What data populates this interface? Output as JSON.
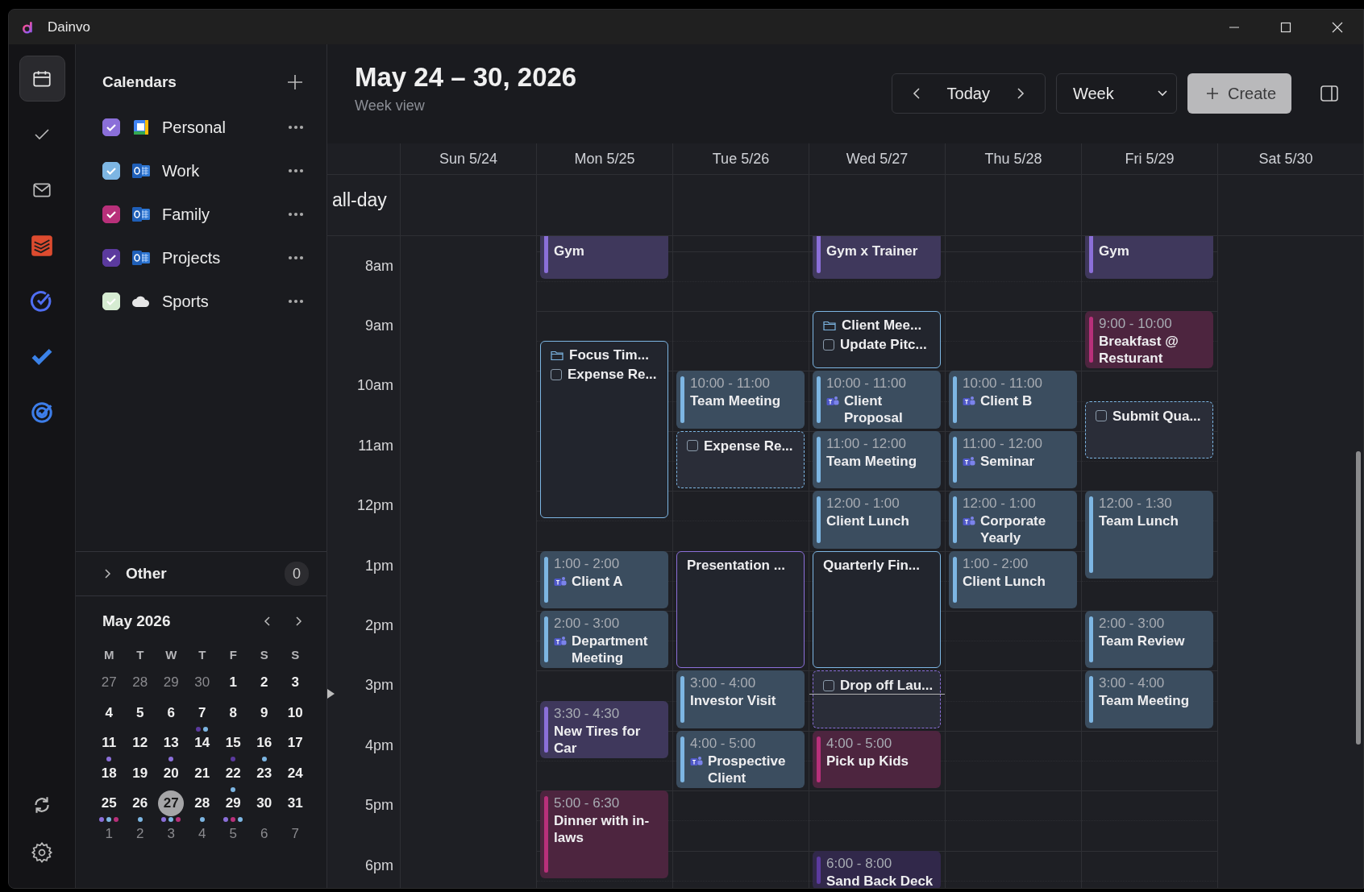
{
  "window": {
    "title": "Dainvo"
  },
  "rail": [
    {
      "kind": "calendar",
      "selected": true
    },
    {
      "kind": "check",
      "selected": false
    },
    {
      "kind": "mail",
      "selected": false
    },
    {
      "kind": "stack",
      "selected": false
    },
    {
      "kind": "ring-check",
      "selected": false
    },
    {
      "kind": "blue-check",
      "selected": false
    },
    {
      "kind": "target-check",
      "selected": false
    }
  ],
  "rail_bottom": [
    {
      "kind": "sync"
    },
    {
      "kind": "settings"
    }
  ],
  "calendars": {
    "title": "Calendars",
    "items": [
      {
        "label": "Personal",
        "checked": true,
        "color": "#8b6fd9",
        "kind": "google"
      },
      {
        "label": "Work",
        "checked": true,
        "color": "#7db6e3",
        "kind": "outlook"
      },
      {
        "label": "Family",
        "checked": true,
        "color": "#b8307a",
        "kind": "outlook"
      },
      {
        "label": "Projects",
        "checked": true,
        "color": "#5b3a9e",
        "kind": "outlook"
      },
      {
        "label": "Sports",
        "checked": true,
        "color": "#d6ecd2",
        "kind": "cloud"
      }
    ]
  },
  "other": {
    "label": "Other",
    "count": "0",
    "expanded": false
  },
  "mini_calendar": {
    "title": "May 2026",
    "weekdays": [
      "M",
      "T",
      "W",
      "T",
      "F",
      "S",
      "S"
    ],
    "days": [
      {
        "label": "27",
        "muted": true,
        "selected": false
      },
      {
        "label": "28",
        "muted": true,
        "selected": false
      },
      {
        "label": "29",
        "muted": true,
        "selected": false
      },
      {
        "label": "30",
        "muted": true,
        "selected": false
      },
      {
        "label": "1",
        "muted": false,
        "selected": false
      },
      {
        "label": "2",
        "muted": false,
        "selected": false
      },
      {
        "label": "3",
        "muted": false,
        "selected": false
      },
      {
        "label": "4",
        "muted": false,
        "selected": false
      },
      {
        "label": "5",
        "muted": false,
        "selected": false
      },
      {
        "label": "6",
        "muted": false,
        "selected": false
      },
      {
        "label": "7",
        "muted": false,
        "selected": false,
        "dots": [
          {
            "color": "#5b3a9e"
          },
          {
            "color": "#7db6e3"
          }
        ]
      },
      {
        "label": "8",
        "muted": false,
        "selected": false
      },
      {
        "label": "9",
        "muted": false,
        "selected": false
      },
      {
        "label": "10",
        "muted": false,
        "selected": false
      },
      {
        "label": "11",
        "muted": false,
        "selected": false,
        "dots": [
          {
            "color": "#8b6fd9"
          }
        ]
      },
      {
        "label": "12",
        "muted": false,
        "selected": false
      },
      {
        "label": "13",
        "muted": false,
        "selected": false,
        "dots": [
          {
            "color": "#8b6fd9"
          }
        ]
      },
      {
        "label": "14",
        "muted": false,
        "selected": false
      },
      {
        "label": "15",
        "muted": false,
        "selected": false,
        "dots": [
          {
            "color": "#5b3a9e"
          }
        ]
      },
      {
        "label": "16",
        "muted": false,
        "selected": false,
        "dots": [
          {
            "color": "#7db6e3"
          }
        ]
      },
      {
        "label": "17",
        "muted": false,
        "selected": false
      },
      {
        "label": "18",
        "muted": false,
        "selected": false
      },
      {
        "label": "19",
        "muted": false,
        "selected": false
      },
      {
        "label": "20",
        "muted": false,
        "selected": false
      },
      {
        "label": "21",
        "muted": false,
        "selected": false
      },
      {
        "label": "22",
        "muted": false,
        "selected": false,
        "dots": [
          {
            "color": "#7db6e3"
          }
        ]
      },
      {
        "label": "23",
        "muted": false,
        "selected": false
      },
      {
        "label": "24",
        "muted": false,
        "selected": false
      },
      {
        "label": "25",
        "muted": false,
        "selected": false,
        "dots": [
          {
            "color": "#8b6fd9"
          },
          {
            "color": "#7db6e3"
          },
          {
            "color": "#b8307a"
          }
        ]
      },
      {
        "label": "26",
        "muted": false,
        "selected": false,
        "dots": [
          {
            "color": "#7db6e3"
          }
        ]
      },
      {
        "label": "27",
        "muted": false,
        "selected": true,
        "dots": [
          {
            "color": "#8b6fd9"
          },
          {
            "color": "#7db6e3"
          },
          {
            "color": "#b8307a"
          }
        ]
      },
      {
        "label": "28",
        "muted": false,
        "selected": false,
        "dots": [
          {
            "color": "#7db6e3"
          }
        ]
      },
      {
        "label": "29",
        "muted": false,
        "selected": false,
        "dots": [
          {
            "color": "#8b6fd9"
          },
          {
            "color": "#b8307a"
          },
          {
            "color": "#7db6e3"
          }
        ]
      },
      {
        "label": "30",
        "muted": false,
        "selected": false
      },
      {
        "label": "31",
        "muted": false,
        "selected": false
      },
      {
        "label": "1",
        "muted": true,
        "selected": false
      },
      {
        "label": "2",
        "muted": true,
        "selected": false
      },
      {
        "label": "3",
        "muted": true,
        "selected": false
      },
      {
        "label": "4",
        "muted": true,
        "selected": false
      },
      {
        "label": "5",
        "muted": true,
        "selected": false
      },
      {
        "label": "6",
        "muted": true,
        "selected": false
      },
      {
        "label": "7",
        "muted": true,
        "selected": false
      }
    ]
  },
  "header": {
    "title": "May 24 – 30, 2026",
    "subtitle": "Week view",
    "today": "Today",
    "view": "Week",
    "create": "Create"
  },
  "allday_label": "all-day",
  "hours": [
    "8am",
    "9am",
    "10am",
    "11am",
    "12pm",
    "1pm",
    "2pm",
    "3pm",
    "4pm",
    "5pm",
    "6pm"
  ],
  "days": [
    {
      "label": "Sun 5/24"
    },
    {
      "label": "Mon 5/25",
      "events": [
        {
          "kind": "event",
          "color": "#8b6fd9",
          "title": "Gym"
        },
        {
          "kind": "group",
          "color": "#7db6e3",
          "items": [
            {
              "kind": "folder",
              "text": "Focus Tim..."
            },
            {
              "kind": "task",
              "text": "Expense Re...",
              "checked": false
            }
          ]
        },
        {
          "kind": "event",
          "color": "#7db6e3",
          "time": "1:00 - 2:00",
          "title": "Client A",
          "teams": true
        },
        {
          "kind": "event",
          "color": "#7db6e3",
          "time": "2:00 - 3:00",
          "title": "Department Meeting",
          "teams": true
        },
        {
          "kind": "event",
          "color": "#8b6fd9",
          "time": "3:30 - 4:30",
          "title": "New Tires for Car"
        },
        {
          "kind": "event",
          "color": "#b8307a",
          "time": "5:00 - 6:30",
          "title": "Dinner with in-laws"
        }
      ]
    },
    {
      "label": "Tue 5/26",
      "events": [
        {
          "kind": "event",
          "color": "#7db6e3",
          "time": "10:00 - 11:00",
          "title": "Team Meeting"
        },
        {
          "kind": "task",
          "color": "#7db6e3",
          "title": "Expense Re...",
          "checked": false
        },
        {
          "kind": "group",
          "color": "#8b6fd9",
          "items": [
            {
              "kind": "plain",
              "text": "Presentation ..."
            }
          ]
        },
        {
          "kind": "event",
          "color": "#7db6e3",
          "time": "3:00 - 4:00",
          "title": "Investor Visit"
        },
        {
          "kind": "event",
          "color": "#7db6e3",
          "time": "4:00 - 5:00",
          "title": "Prospective Client",
          "teams": true
        }
      ]
    },
    {
      "label": "Wed 5/27",
      "events": [
        {
          "kind": "event",
          "color": "#8b6fd9",
          "title": "Gym x Trainer"
        },
        {
          "kind": "group",
          "color": "#7db6e3",
          "items": [
            {
              "kind": "folder",
              "text": "Client Mee..."
            },
            {
              "kind": "task",
              "text": "Update Pitc...",
              "checked": false
            }
          ]
        },
        {
          "kind": "event",
          "color": "#7db6e3",
          "time": "10:00 - 11:00",
          "title": "Client Proposal",
          "teams": true
        },
        {
          "kind": "event",
          "color": "#7db6e3",
          "time": "11:00 - 12:00",
          "title": "Team Meeting"
        },
        {
          "kind": "event",
          "color": "#7db6e3",
          "time": "12:00 - 1:00",
          "title": "Client Lunch"
        },
        {
          "kind": "group",
          "color": "#7db6e3",
          "items": [
            {
              "kind": "plain",
              "text": "Quarterly Fin..."
            }
          ]
        },
        {
          "kind": "task",
          "color": "#8b6fd9",
          "title": "Drop off Lau...",
          "checked": false
        },
        {
          "kind": "event",
          "color": "#b8307a",
          "time": "4:00 - 5:00",
          "title": "Pick up Kids"
        },
        {
          "kind": "event",
          "color": "#5b3a9e",
          "time": "6:00 - 8:00",
          "title": "Sand Back Deck"
        }
      ]
    },
    {
      "label": "Thu 5/28",
      "events": [
        {
          "kind": "event",
          "color": "#7db6e3",
          "time": "10:00 - 11:00",
          "title": "Client B",
          "teams": true
        },
        {
          "kind": "event",
          "color": "#7db6e3",
          "time": "11:00 - 12:00",
          "title": "Seminar",
          "teams": true
        },
        {
          "kind": "event",
          "color": "#7db6e3",
          "time": "12:00 - 1:00",
          "title": "Corporate Yearly",
          "teams": true
        },
        {
          "kind": "event",
          "color": "#7db6e3",
          "time": "1:00 - 2:00",
          "title": "Client Lunch"
        }
      ]
    },
    {
      "label": "Fri 5/29",
      "events": [
        {
          "kind": "event",
          "color": "#8b6fd9",
          "title": "Gym"
        },
        {
          "kind": "event",
          "color": "#b8307a",
          "time": "9:00 - 10:00",
          "title": "Breakfast @ Resturant"
        },
        {
          "kind": "task",
          "color": "#7db6e3",
          "title": "Submit Qua...",
          "checked": false
        },
        {
          "kind": "event",
          "color": "#7db6e3",
          "time": "12:00 - 1:30",
          "title": "Team Lunch"
        },
        {
          "kind": "event",
          "color": "#7db6e3",
          "time": "2:00 - 3:00",
          "title": "Team Review"
        },
        {
          "kind": "event",
          "color": "#7db6e3",
          "time": "3:00 - 4:00",
          "title": "Team Meeting"
        }
      ]
    },
    {
      "label": "Sat 5/30"
    }
  ]
}
